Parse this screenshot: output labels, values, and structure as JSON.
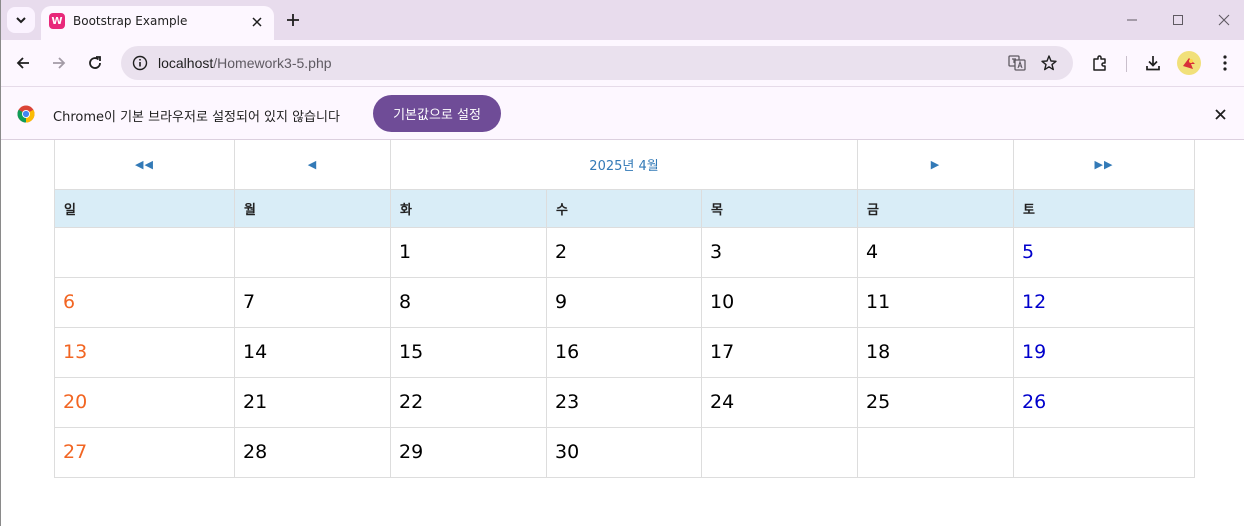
{
  "browser": {
    "tab_title": "Bootstrap Example",
    "tab_favicon_glyph": "W",
    "url_host": "localhost",
    "url_path": "/Homework3-5.php",
    "accent": "#6f4c97"
  },
  "infobar": {
    "message": "Chrome이 기본 브라우저로 설정되어 있지 않습니다",
    "button_label": "기본값으로 설정"
  },
  "calendar": {
    "nav": {
      "prev_year": "◀◀",
      "prev_month": "◀",
      "title": "2025년 4월",
      "next_month": "▶",
      "next_year": "▶▶"
    },
    "weekdays": [
      "일",
      "월",
      "화",
      "수",
      "목",
      "금",
      "토"
    ],
    "weeks": [
      [
        "",
        "",
        "1",
        "2",
        "3",
        "4",
        "5"
      ],
      [
        "6",
        "7",
        "8",
        "9",
        "10",
        "11",
        "12"
      ],
      [
        "13",
        "14",
        "15",
        "16",
        "17",
        "18",
        "19"
      ],
      [
        "20",
        "21",
        "22",
        "23",
        "24",
        "25",
        "26"
      ],
      [
        "27",
        "28",
        "29",
        "30",
        "",
        "",
        ""
      ]
    ],
    "colors": {
      "sunday": "#f26522",
      "saturday": "#0000cc",
      "link": "#337ab7",
      "header_bg": "#d9edf7"
    }
  }
}
